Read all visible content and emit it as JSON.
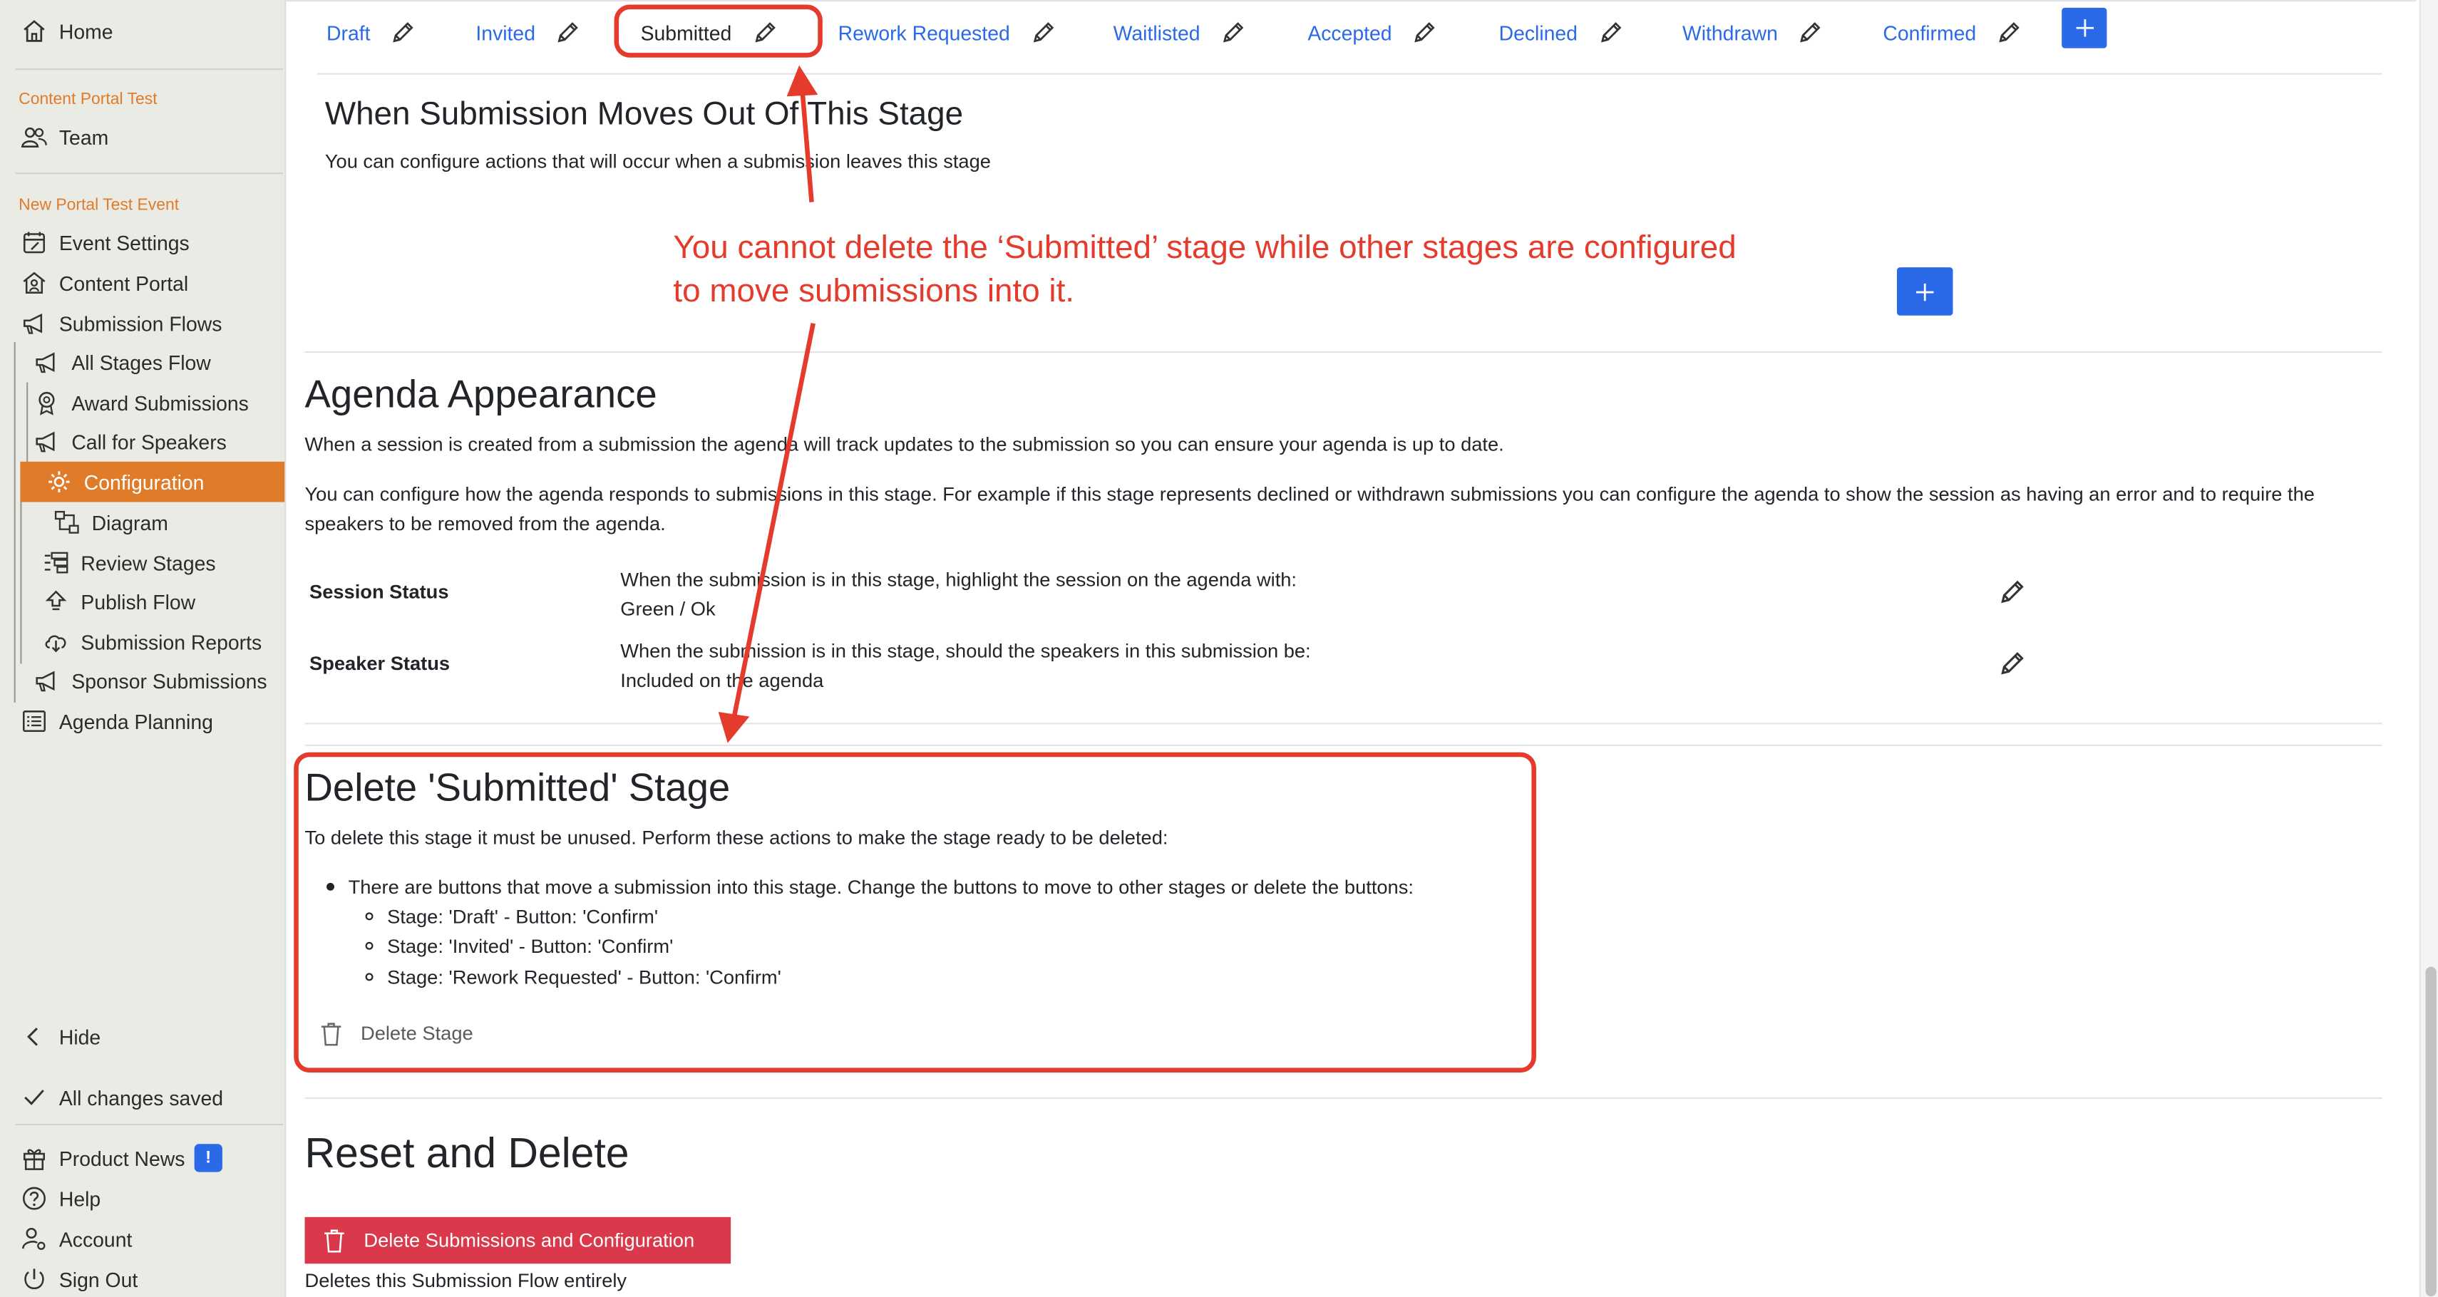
{
  "sidebar": {
    "home": "Home",
    "section1": "Content Portal Test",
    "team": "Team",
    "section2": "New Portal Test Event",
    "items": [
      {
        "label": "Event Settings"
      },
      {
        "label": "Content Portal"
      },
      {
        "label": "Submission Flows"
      },
      {
        "label": "All Stages Flow"
      },
      {
        "label": "Award Submissions"
      },
      {
        "label": "Call for Speakers"
      },
      {
        "label": "Configuration"
      },
      {
        "label": "Diagram"
      },
      {
        "label": "Review Stages"
      },
      {
        "label": "Publish Flow"
      },
      {
        "label": "Submission Reports"
      },
      {
        "label": "Sponsor Submissions"
      },
      {
        "label": "Agenda Planning"
      }
    ],
    "hide": "Hide",
    "saved": "All changes saved",
    "product_news": "Product News",
    "news_badge": "!",
    "help": "Help",
    "account": "Account",
    "sign_out": "Sign Out"
  },
  "tabs": [
    "Draft",
    "Invited",
    "Submitted",
    "Rework Requested",
    "Waitlisted",
    "Accepted",
    "Declined",
    "Withdrawn",
    "Confirmed"
  ],
  "leave_section": {
    "title": "When Submission Moves Out Of This Stage",
    "desc": "You can configure actions that will occur when a submission leaves this stage"
  },
  "agenda": {
    "title": "Agenda Appearance",
    "p1": "When a session is created from a submission the agenda will track updates to the submission so you can ensure your agenda is up to date.",
    "p2": "You can configure how the agenda responds to submissions in this stage. For example if this stage represents declined or withdrawn submissions you can configure the agenda to show the session as having an error and to require the speakers to be removed from the agenda.",
    "session_label": "Session Status",
    "session_q": "When the submission is in this stage, highlight the session on the agenda with:",
    "session_val": "Green / Ok",
    "speaker_label": "Speaker Status",
    "speaker_q": "When the submission is in this stage, should the speakers in this submission be:",
    "speaker_val": "Included on the agenda"
  },
  "delete_stage": {
    "title": "Delete 'Submitted' Stage",
    "desc": "To delete this stage it must be unused. Perform these actions to make the stage ready to be deleted:",
    "bullet": "There are buttons that move a submission into this stage. Change the buttons to move to other stages or delete the buttons:",
    "sub": [
      "Stage: 'Draft' - Button: 'Confirm'",
      "Stage: 'Invited' - Button: 'Confirm'",
      "Stage: 'Rework Requested' - Button: 'Confirm'"
    ],
    "button": "Delete Stage"
  },
  "reset": {
    "title": "Reset and Delete",
    "button": "Delete Submissions and Configuration",
    "note": "Deletes this Submission Flow entirely"
  },
  "annotation": {
    "line1": "You cannot delete the ‘Submitted’ stage while other stages are configured",
    "line2": "to move submissions into it.",
    "color": "#e53b2c"
  },
  "colors": {
    "accent": "#2a6ae8",
    "sidebar_active": "#e07b2a",
    "danger": "#d9394a"
  }
}
